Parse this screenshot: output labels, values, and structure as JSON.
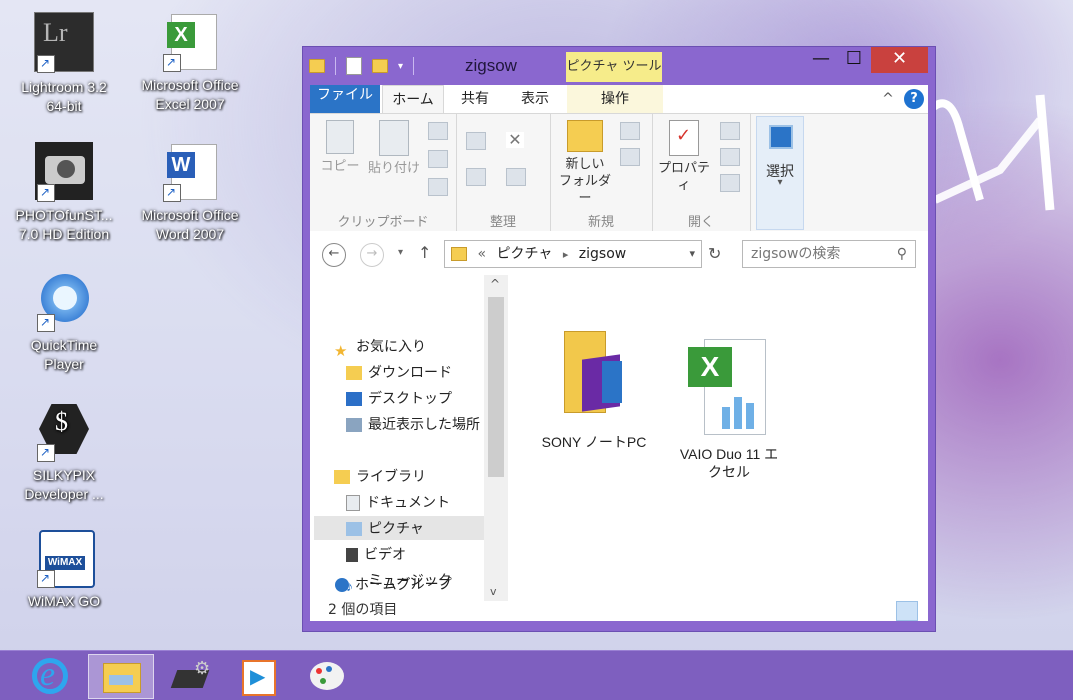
{
  "desktop": {
    "icons": [
      {
        "line1": "Lightroom 3.2",
        "line2": "64-bit",
        "icon": "lightroom-icon"
      },
      {
        "line1": "Microsoft Office",
        "line2": "Excel 2007",
        "icon": "excel-icon"
      },
      {
        "line1": "PHOTOfunST...",
        "line2": "7.0 HD Edition",
        "icon": "camera-icon"
      },
      {
        "line1": "Microsoft Office",
        "line2": "Word 2007",
        "icon": "word-icon"
      },
      {
        "line1": "QuickTime",
        "line2": "Player",
        "icon": "quicktime-icon"
      },
      {
        "line1": "SILKYPIX",
        "line2": "Developer ...",
        "icon": "silkypix-icon"
      },
      {
        "line1": "WiMAX GO",
        "line2": "",
        "icon": "wimax-icon"
      }
    ]
  },
  "window": {
    "title": "zigsow",
    "context_tab": "ピクチャ ツール",
    "controls": {
      "minimize": "—",
      "maximize": "☐",
      "close": "✕"
    },
    "tabs": {
      "file": "ファイル",
      "home": "ホーム",
      "share": "共有",
      "view": "表示",
      "manage": "操作"
    },
    "ribbon": {
      "clipboard": {
        "copy": "コピー",
        "paste": "貼り付け",
        "label": "クリップボード"
      },
      "organize": {
        "label": "整理"
      },
      "new": {
        "new_folder_1": "新しい",
        "new_folder_2": "フォルダー",
        "label": "新規"
      },
      "open": {
        "properties": "プロパティ",
        "label": "開く"
      },
      "select": {
        "label": "選択"
      }
    },
    "address": {
      "sep": "«",
      "path1": "ピクチャ",
      "arrow": "▸",
      "path2": "zigsow"
    },
    "search_placeholder": "zigsowの検索",
    "nav": {
      "favorites": "お気に入り",
      "downloads": "ダウンロード",
      "desktop": "デスクトップ",
      "recent": "最近表示した場所",
      "libraries": "ライブラリ",
      "documents": "ドキュメント",
      "pictures": "ピクチャ",
      "videos": "ビデオ",
      "music": "ミュージック",
      "homegroup": "ホームグループ"
    },
    "files": [
      {
        "name": "SONY ノートPC",
        "icon": "folder-icon"
      },
      {
        "name_1": "VAIO Duo 11 エ",
        "name_2": "クセル",
        "icon": "excel-file-icon"
      }
    ],
    "status": "2 個の項目"
  },
  "taskbar": {
    "items": [
      "ie-icon",
      "explorer-icon",
      "devices-icon",
      "media-icon",
      "paint-icon"
    ]
  },
  "colors": {
    "accent": "#8a67cf",
    "taskbar": "#7e5fbf",
    "file_tab": "#2b74c7",
    "close": "#c9413e",
    "context": "#f6ec8a"
  }
}
